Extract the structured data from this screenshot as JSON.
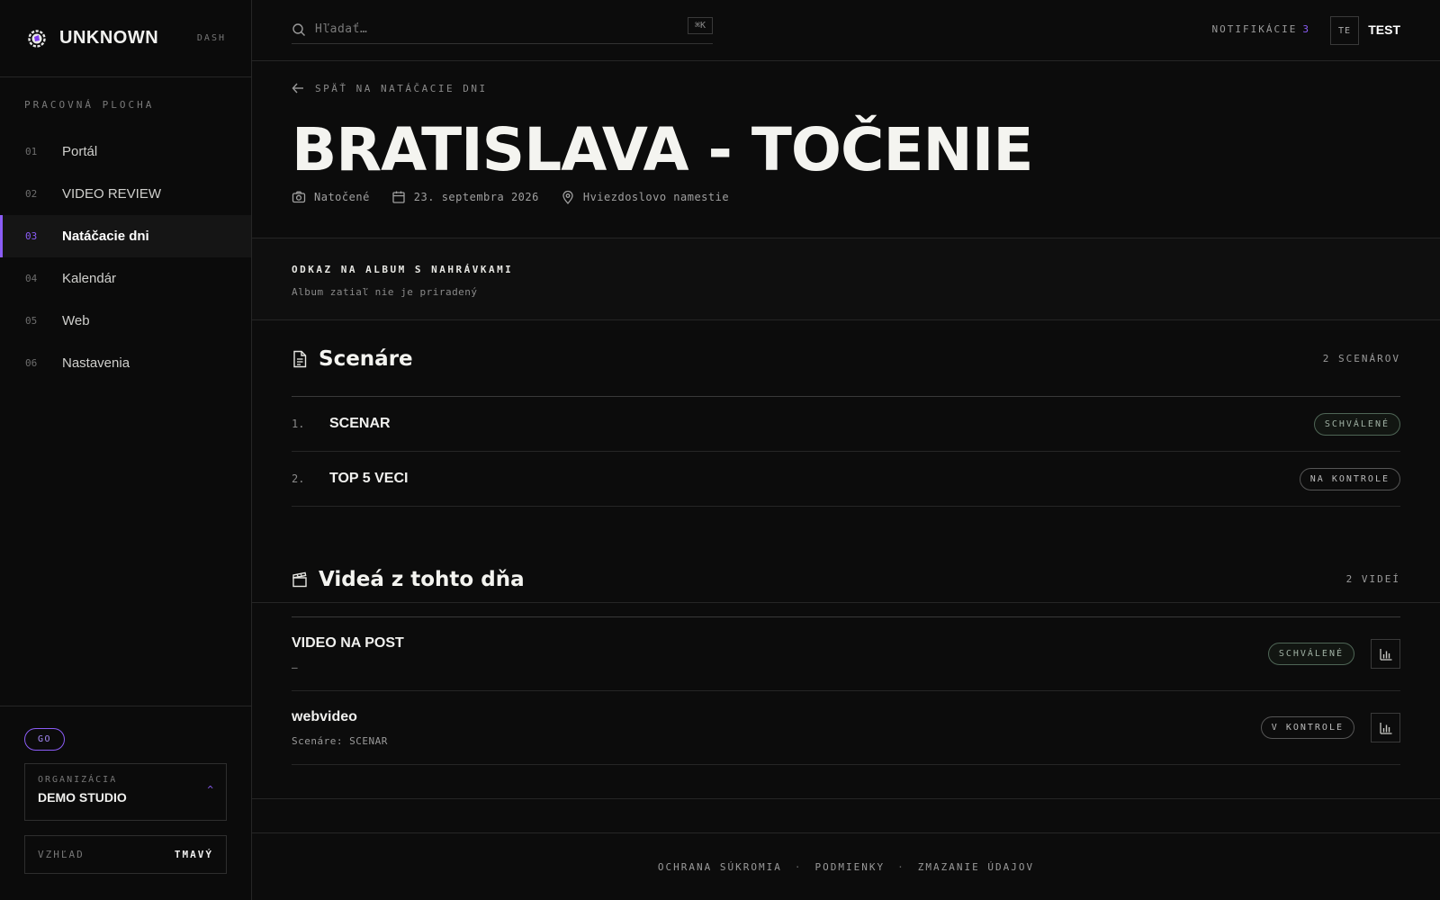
{
  "brand": {
    "name": "UNKNOWN",
    "sub": "DASH"
  },
  "sidebar": {
    "section_label": "PRACOVNÁ PLOCHA",
    "items": [
      {
        "num": "01",
        "label": "Portál"
      },
      {
        "num": "02",
        "label": "VIDEO REVIEW"
      },
      {
        "num": "03",
        "label": "Natáčacie dni",
        "active": true
      },
      {
        "num": "04",
        "label": "Kalendár"
      },
      {
        "num": "05",
        "label": "Web"
      },
      {
        "num": "06",
        "label": "Nastavenia"
      }
    ],
    "badge": "GO",
    "org": {
      "label": "ORGANIZÁCIA",
      "name": "DEMO STUDIO",
      "caret": "^"
    },
    "theme": {
      "label": "VZHĽAD",
      "value": "TMAVÝ"
    }
  },
  "topbar": {
    "search_placeholder": "Hľadať…",
    "shortcut": "⌘K",
    "notifications_label": "NOTIFIKÁCIE",
    "notifications_count": "3",
    "avatar": "TE",
    "user": "TEST"
  },
  "page": {
    "back": "SPÄŤ NA NATÁČACIE DNI",
    "title": "BRATISLAVA - TOČENIE",
    "status": "Natočené",
    "date": "23. septembra 2026",
    "location": "Hviezdoslovo namestie"
  },
  "album": {
    "title": "ODKAZ NA ALBUM S NAHRÁVKAMI",
    "sub": "Album zatiaľ nie je priradený"
  },
  "scripts": {
    "title": "Scenáre",
    "count": "2 SCENÁROV",
    "rows": [
      {
        "idx": "1.",
        "title": "SCENAR",
        "status": "SCHVÁLENÉ"
      },
      {
        "idx": "2.",
        "title": "TOP 5 VECI",
        "status": "NA KONTROLE"
      }
    ]
  },
  "videos": {
    "title": "Videá z tohto dňa",
    "count": "2 VIDEÍ",
    "rows": [
      {
        "title": "VIDEO NA POST",
        "sub": "—",
        "status": "SCHVÁLENÉ"
      },
      {
        "title": "webvideo",
        "sub": "Scenáre: SCENAR",
        "status": "V KONTROLE"
      }
    ]
  },
  "footer": {
    "privacy": "OCHRANA SÚKROMIA",
    "terms": "PODMIENKY",
    "delete": "ZMAZANIE ÚDAJOV",
    "sep": "·"
  },
  "colors": {
    "accent": "#8b5cf6",
    "background": "#0c0c0c",
    "approved": "#9fb0a3"
  }
}
